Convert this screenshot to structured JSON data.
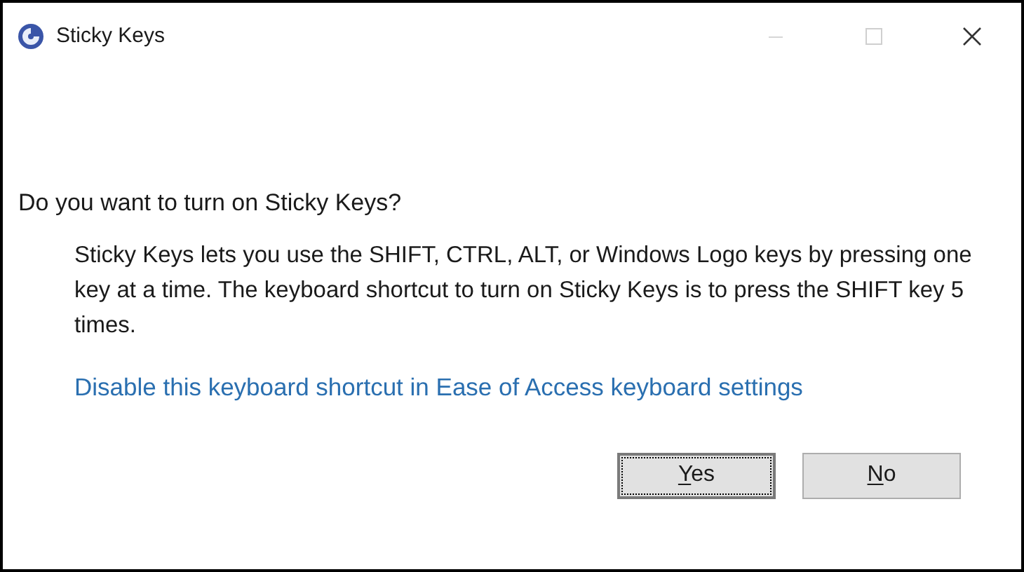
{
  "window": {
    "title": "Sticky Keys",
    "maximize_disabled": true
  },
  "question": "Do you want to turn on Sticky Keys?",
  "description": "Sticky Keys lets you use the SHIFT, CTRL, ALT, or Windows Logo keys by pressing one key at a time. The keyboard shortcut to turn on Sticky Keys is to press the SHIFT key 5 times.",
  "link": "Disable this keyboard shortcut in Ease of Access keyboard settings",
  "buttons": [
    {
      "label": "Yes",
      "focused": true,
      "underline_first": true
    },
    {
      "label": "No",
      "focused": false,
      "underline_first": true
    }
  ]
}
